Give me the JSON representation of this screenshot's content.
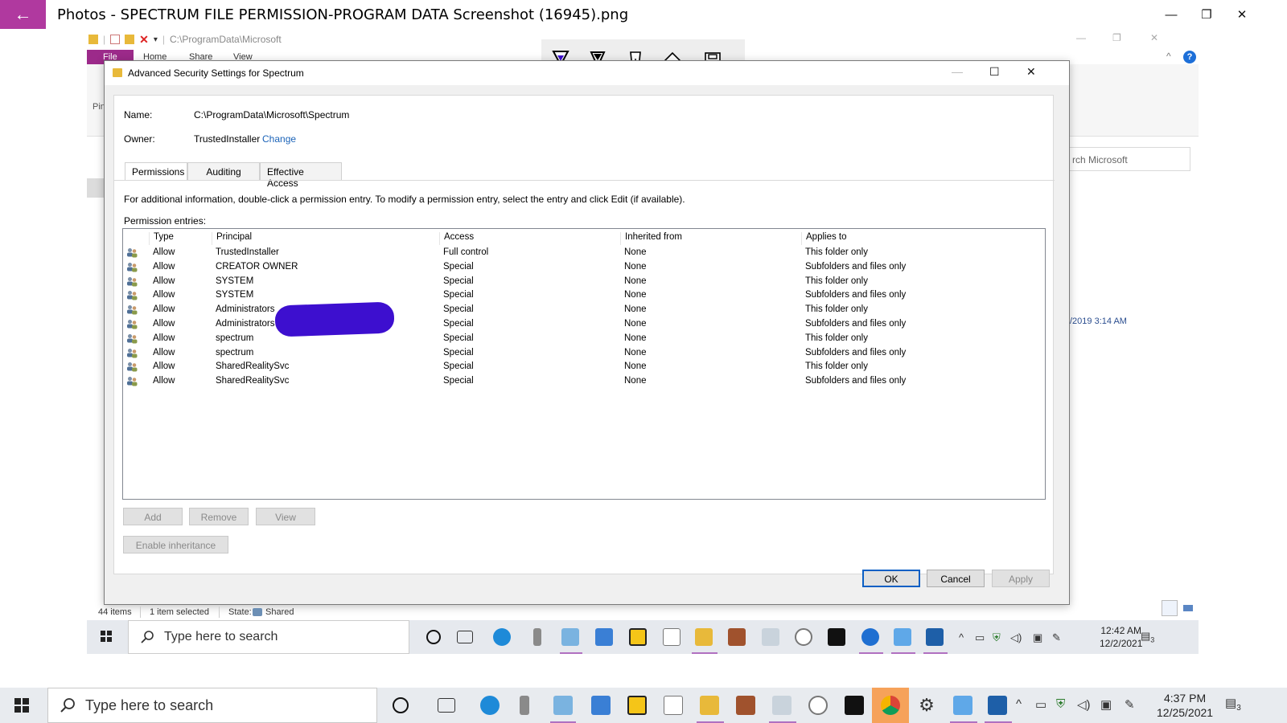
{
  "photos": {
    "title": "Photos - SPECTRUM FILE PERMISSION-PROGRAM DATA Screenshot (16945).png",
    "back": "←",
    "minimize": "—",
    "restore": "❐",
    "close": "✕"
  },
  "explorer": {
    "path": "C:\\ProgramData\\Microsoft",
    "ribbon_tabs": [
      "File",
      "Home",
      "Share",
      "View"
    ],
    "pin_label": "Pin",
    "search_placeholder": "rch Microsoft",
    "date_fragment": "/2019 3:14 AM",
    "status": {
      "items": "44 items",
      "selected": "1 item selected",
      "state_label": "State:",
      "state_value": "Shared"
    }
  },
  "pen_toolbar": {
    "tools": [
      "ballpoint-pen",
      "pencil",
      "calligraphy-pen",
      "eraser",
      "save"
    ],
    "active_index": 0
  },
  "dialog": {
    "title": "Advanced Security Settings for Spectrum",
    "name_label": "Name:",
    "name_value": "C:\\ProgramData\\Microsoft\\Spectrum",
    "owner_label": "Owner:",
    "owner_value": "TrustedInstaller",
    "owner_change": "Change",
    "tabs": [
      "Permissions",
      "Auditing",
      "Effective Access"
    ],
    "active_tab": "Permissions",
    "info": "For additional information, double-click a permission entry. To modify a permission entry, select the entry and click Edit (if available).",
    "entries_label": "Permission entries:",
    "columns": [
      "Type",
      "Principal",
      "Access",
      "Inherited from",
      "Applies to"
    ],
    "rows": [
      {
        "type": "Allow",
        "principal": "TrustedInstaller",
        "access": "Full control",
        "inherited": "None",
        "applies": "This folder only"
      },
      {
        "type": "Allow",
        "principal": "CREATOR OWNER",
        "access": "Special",
        "inherited": "None",
        "applies": "Subfolders and files only"
      },
      {
        "type": "Allow",
        "principal": "SYSTEM",
        "access": "Special",
        "inherited": "None",
        "applies": "This folder only"
      },
      {
        "type": "Allow",
        "principal": "SYSTEM",
        "access": "Special",
        "inherited": "None",
        "applies": "Subfolders and files only"
      },
      {
        "type": "Allow",
        "principal": "Administrators",
        "access": "Special",
        "inherited": "None",
        "applies": "This folder only"
      },
      {
        "type": "Allow",
        "principal": "Administrators",
        "access": "Special",
        "inherited": "None",
        "applies": "Subfolders and files only"
      },
      {
        "type": "Allow",
        "principal": "spectrum",
        "access": "Special",
        "inherited": "None",
        "applies": "This folder only"
      },
      {
        "type": "Allow",
        "principal": "spectrum",
        "access": "Special",
        "inherited": "None",
        "applies": "Subfolders and files only"
      },
      {
        "type": "Allow",
        "principal": "SharedRealitySvc",
        "access": "Special",
        "inherited": "None",
        "applies": "This folder only"
      },
      {
        "type": "Allow",
        "principal": "SharedRealitySvc",
        "access": "Special",
        "inherited": "None",
        "applies": "Subfolders and files only"
      }
    ],
    "buttons": {
      "add": "Add",
      "remove": "Remove",
      "view": "View",
      "enable_inheritance": "Enable inheritance",
      "ok": "OK",
      "cancel": "Cancel",
      "apply": "Apply"
    }
  },
  "inner_taskbar": {
    "search_placeholder": "Type here to search",
    "time": "12:42 AM",
    "date": "12/2/2021",
    "notif_count": "3"
  },
  "taskbar": {
    "search_placeholder": "Type here to search",
    "time": "4:37 PM",
    "date": "12/25/2021",
    "notif_count": "3"
  },
  "colors": {
    "photos_accent": "#b0399f",
    "link": "#1b63b8",
    "redaction": "#3d0fcf",
    "default_button_border": "#0a5fc4"
  }
}
